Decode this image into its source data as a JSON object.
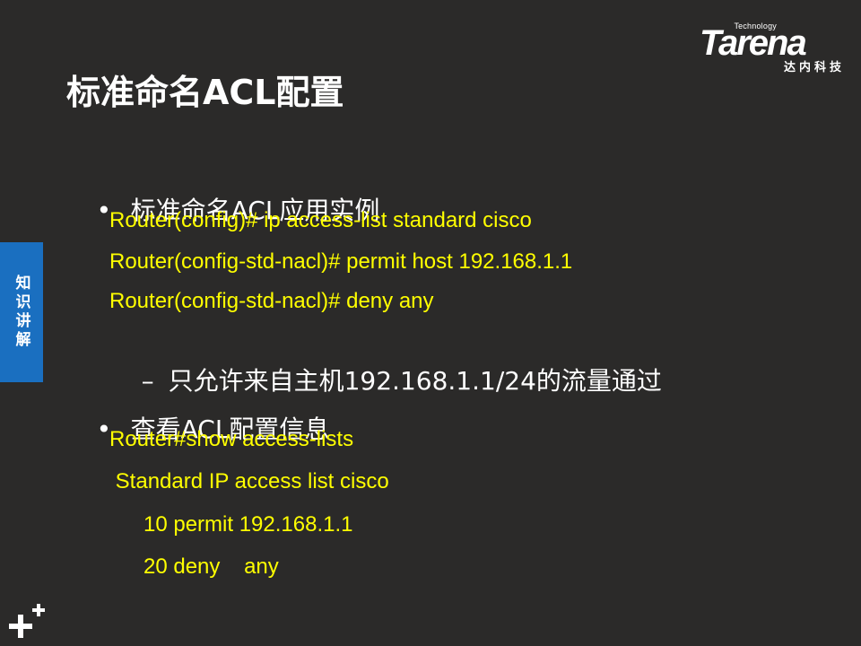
{
  "logo": {
    "small_text": "Technology",
    "word": "Tarena",
    "chinese": "达内科技"
  },
  "title": "标准命名ACL配置",
  "side_tab": "知识讲解",
  "bullets": [
    {
      "text": "标准命名ACL应用实例",
      "code_lines": [
        "Router(config)# ip access-list standard cisco",
        "Router(config-std-nacl)# permit host 192.168.1.1",
        "Router(config-std-nacl)# deny any"
      ],
      "sub_item": "只允许来自主机192.168.1.1/24的流量通过"
    },
    {
      "text": "查看ACL配置信息",
      "code_lines": [
        "Router#show access-lists",
        " Standard IP access list cisco",
        "10 permit 192.168.1.1",
        "20 deny    any"
      ]
    }
  ],
  "colors": {
    "background": "#2b2a29",
    "code": "#ffff00",
    "side_tab": "#1a6fc0",
    "text": "#ffffff"
  },
  "icons": {
    "bottom_left": "plus-icon",
    "bullet": "bullet-dot",
    "sub_bullet": "dash"
  }
}
